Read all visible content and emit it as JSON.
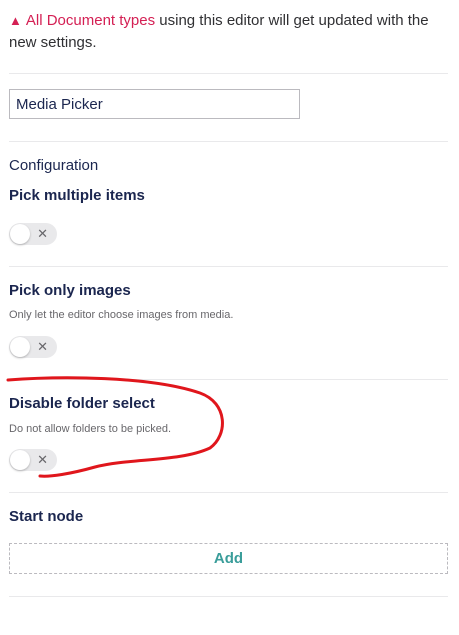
{
  "notice": {
    "icon": "warning-icon",
    "strong_text": "All Document types",
    "rest_text": " using this editor will get updated with the new settings."
  },
  "editor_name": {
    "value": "Media Picker"
  },
  "configuration": {
    "heading": "Configuration",
    "properties": [
      {
        "label": "Pick multiple items",
        "description": "",
        "enabled": false
      },
      {
        "label": "Pick only images",
        "description": "Only let the editor choose images from media.",
        "enabled": false
      },
      {
        "label": "Disable folder select",
        "description": "Do not allow folders to be picked.",
        "enabled": false
      }
    ],
    "start_node": {
      "label": "Start node",
      "add_label": "Add"
    }
  },
  "colors": {
    "warning": "#d42054",
    "add_text": "#3a9d9a",
    "annotation": "#e0161c"
  }
}
